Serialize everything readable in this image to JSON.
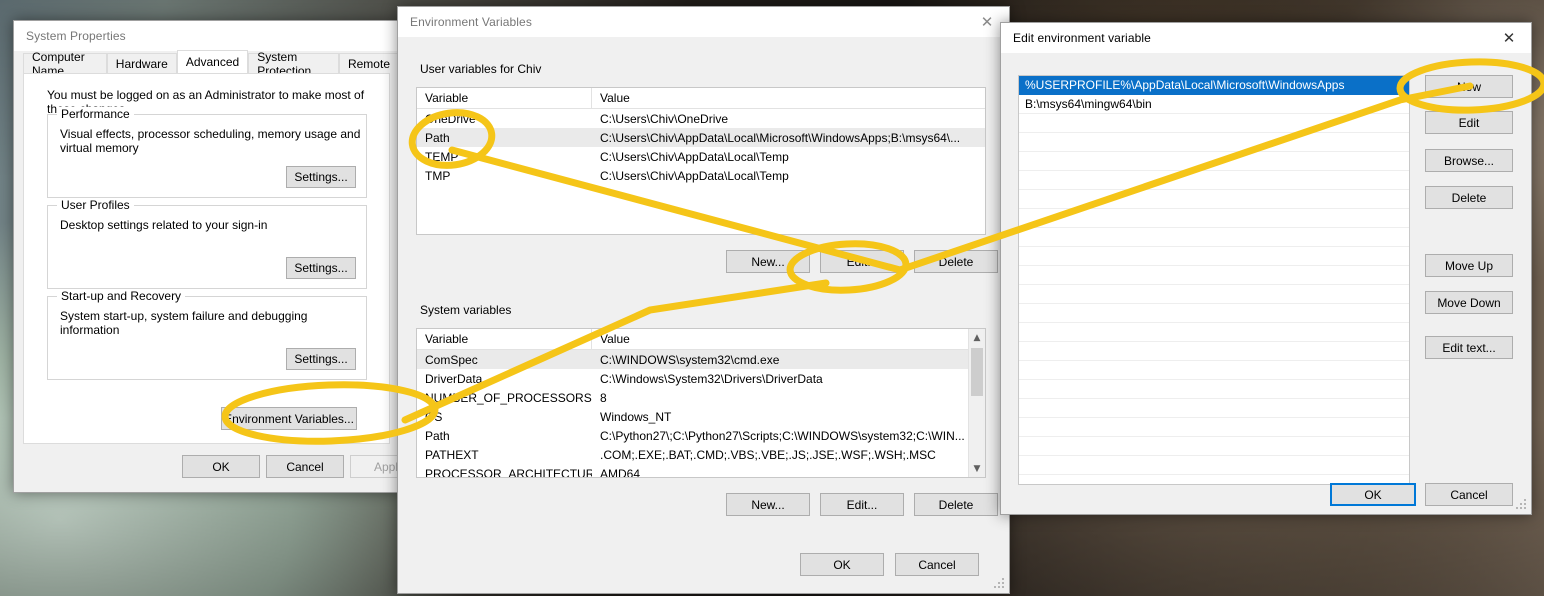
{
  "system_properties": {
    "title": "System Properties",
    "close_icon": "close-icon",
    "tabs": [
      {
        "label": "Computer Name",
        "active": false
      },
      {
        "label": "Hardware",
        "active": false
      },
      {
        "label": "Advanced",
        "active": true
      },
      {
        "label": "System Protection",
        "active": false
      },
      {
        "label": "Remote",
        "active": false
      }
    ],
    "note": "You must be logged on as an Administrator to make most of these changes.",
    "groups": [
      {
        "legend": "Performance",
        "description": "Visual effects, processor scheduling, memory usage and virtual memory",
        "button": "Settings..."
      },
      {
        "legend": "User Profiles",
        "description": "Desktop settings related to your sign-in",
        "button": "Settings..."
      },
      {
        "legend": "Start-up and Recovery",
        "description": "System start-up, system failure and debugging information",
        "button": "Settings..."
      }
    ],
    "env_button": "Environment Variables...",
    "footer": {
      "ok": "OK",
      "cancel": "Cancel",
      "apply": "Apply"
    }
  },
  "environment_variables": {
    "title": "Environment Variables",
    "close_icon": "close-icon",
    "user_section": {
      "legend": "User variables for Chiv",
      "columns": [
        "Variable",
        "Value"
      ],
      "rows": [
        {
          "variable": "OneDrive",
          "value": "C:\\Users\\Chiv\\OneDrive",
          "selected": false
        },
        {
          "variable": "Path",
          "value": "C:\\Users\\Chiv\\AppData\\Local\\Microsoft\\WindowsApps;B:\\msys64\\...",
          "selected": true
        },
        {
          "variable": "TEMP",
          "value": "C:\\Users\\Chiv\\AppData\\Local\\Temp",
          "selected": false
        },
        {
          "variable": "TMP",
          "value": "C:\\Users\\Chiv\\AppData\\Local\\Temp",
          "selected": false
        }
      ],
      "buttons": {
        "new": "New...",
        "edit": "Edit...",
        "delete": "Delete"
      }
    },
    "system_section": {
      "legend": "System variables",
      "columns": [
        "Variable",
        "Value"
      ],
      "rows": [
        {
          "variable": "ComSpec",
          "value": "C:\\WINDOWS\\system32\\cmd.exe",
          "selected": true
        },
        {
          "variable": "DriverData",
          "value": "C:\\Windows\\System32\\Drivers\\DriverData",
          "selected": false
        },
        {
          "variable": "NUMBER_OF_PROCESSORS",
          "value": "8",
          "selected": false
        },
        {
          "variable": "OS",
          "value": "Windows_NT",
          "selected": false
        },
        {
          "variable": "Path",
          "value": "C:\\Python27\\;C:\\Python27\\Scripts;C:\\WINDOWS\\system32;C:\\WIN...",
          "selected": false
        },
        {
          "variable": "PATHEXT",
          "value": ".COM;.EXE;.BAT;.CMD;.VBS;.VBE;.JS;.JSE;.WSF;.WSH;.MSC",
          "selected": false
        },
        {
          "variable": "PROCESSOR_ARCHITECTURE",
          "value": "AMD64",
          "selected": false
        }
      ],
      "buttons": {
        "new": "New...",
        "edit": "Edit...",
        "delete": "Delete"
      },
      "scroll_up_icon": "chevron-up-icon",
      "scroll_down_icon": "chevron-down-icon"
    },
    "footer": {
      "ok": "OK",
      "cancel": "Cancel"
    }
  },
  "edit_environment_variable": {
    "title": "Edit environment variable",
    "close_icon": "close-icon",
    "entries": [
      {
        "value": "%USERPROFILE%\\AppData\\Local\\Microsoft\\WindowsApps",
        "selected": true
      },
      {
        "value": "B:\\msys64\\mingw64\\bin",
        "selected": false
      }
    ],
    "buttons": {
      "new": "New",
      "edit": "Edit",
      "browse": "Browse...",
      "delete": "Delete",
      "move_up": "Move Up",
      "move_down": "Move Down",
      "edit_text": "Edit text..."
    },
    "footer": {
      "ok": "OK",
      "cancel": "Cancel"
    }
  },
  "annotations": {
    "color": "#f5c518",
    "shapes": [
      {
        "kind": "ellipse",
        "target": "environment-variables-button"
      },
      {
        "kind": "ellipse",
        "target": "user-var-path-row"
      },
      {
        "kind": "ellipse",
        "target": "user-vars-edit-button"
      },
      {
        "kind": "ellipse",
        "target": "edit-dialog-new-button"
      },
      {
        "kind": "line",
        "from": "environment-variables-button",
        "to": "user-vars-edit-button"
      },
      {
        "kind": "line",
        "from": "user-var-path-row",
        "to": "edit-dialog-new-button"
      }
    ]
  }
}
